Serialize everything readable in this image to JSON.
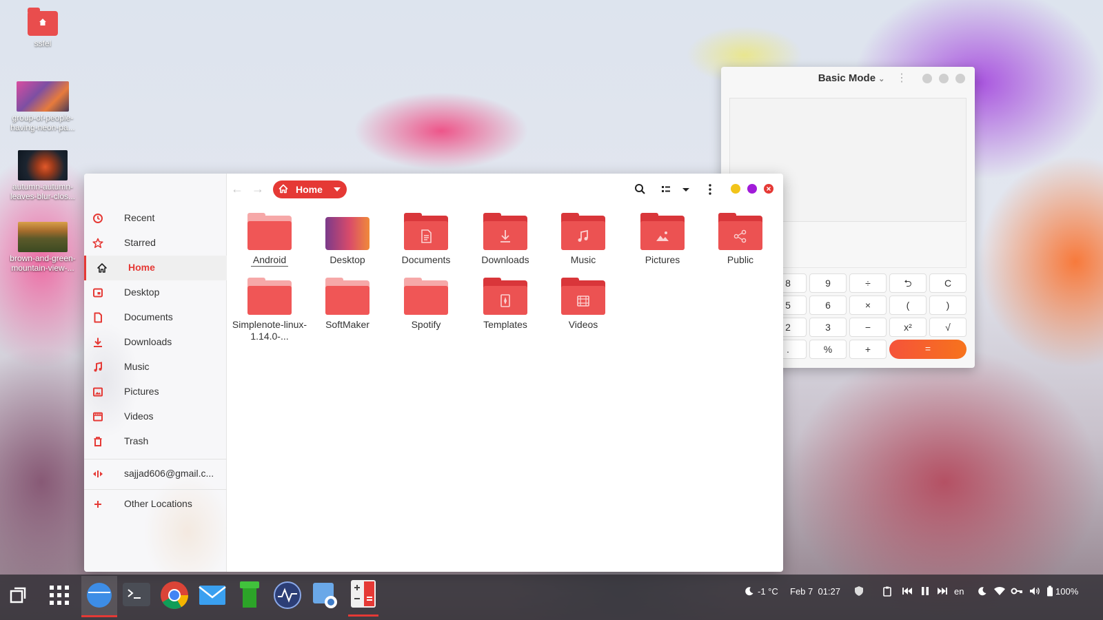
{
  "desktop": {
    "icons": [
      {
        "label": "ssfel",
        "kind": "home-folder"
      },
      {
        "label": "group-of-people-having-neon-pa...",
        "kind": "image"
      },
      {
        "label": "autumn-autumn-leaves-blur-clos...",
        "kind": "image"
      },
      {
        "label": "brown-and-green-mountain-view-...",
        "kind": "image"
      }
    ]
  },
  "calculator": {
    "mode_label": "Basic Mode",
    "buttons": {
      "row1": [
        "8",
        "9",
        "÷",
        "⮌",
        "C"
      ],
      "row2": [
        "5",
        "6",
        "×",
        "(",
        ")"
      ],
      "row3": [
        "2",
        "3",
        "−",
        "x²",
        "√"
      ],
      "row4": [
        ".",
        "%",
        "+",
        "="
      ]
    },
    "accent": "#f5533a"
  },
  "file_manager": {
    "path_label": "Home",
    "accent": "#e53935",
    "sidebar": {
      "items": [
        {
          "label": "Recent",
          "icon": "clock-icon"
        },
        {
          "label": "Starred",
          "icon": "star-icon"
        },
        {
          "label": "Home",
          "icon": "home-icon",
          "active": true
        },
        {
          "label": "Desktop",
          "icon": "desktop-icon"
        },
        {
          "label": "Documents",
          "icon": "document-icon"
        },
        {
          "label": "Downloads",
          "icon": "download-icon"
        },
        {
          "label": "Music",
          "icon": "music-icon"
        },
        {
          "label": "Pictures",
          "icon": "picture-icon"
        },
        {
          "label": "Videos",
          "icon": "film-icon"
        },
        {
          "label": "Trash",
          "icon": "trash-icon"
        }
      ],
      "account_label": "sajjad606@gmail.c...",
      "other_locations_label": "Other Locations"
    },
    "files": [
      {
        "label": "Android",
        "kind": "plain-light"
      },
      {
        "label": "Desktop",
        "kind": "gradient"
      },
      {
        "label": "Documents",
        "kind": "document"
      },
      {
        "label": "Downloads",
        "kind": "download"
      },
      {
        "label": "Music",
        "kind": "music"
      },
      {
        "label": "Pictures",
        "kind": "picture"
      },
      {
        "label": "Public",
        "kind": "share"
      },
      {
        "label": "Simplenote-linux-1.14.0-...",
        "kind": "plain-light"
      },
      {
        "label": "SoftMaker",
        "kind": "plain-light"
      },
      {
        "label": "Spotify",
        "kind": "plain-light"
      },
      {
        "label": "Templates",
        "kind": "template"
      },
      {
        "label": "Videos",
        "kind": "film"
      }
    ]
  },
  "taskbar": {
    "weather": "-1 °C",
    "datetime": "Feb 7  01:27",
    "keyboard_layout": "en",
    "battery": "100%"
  }
}
